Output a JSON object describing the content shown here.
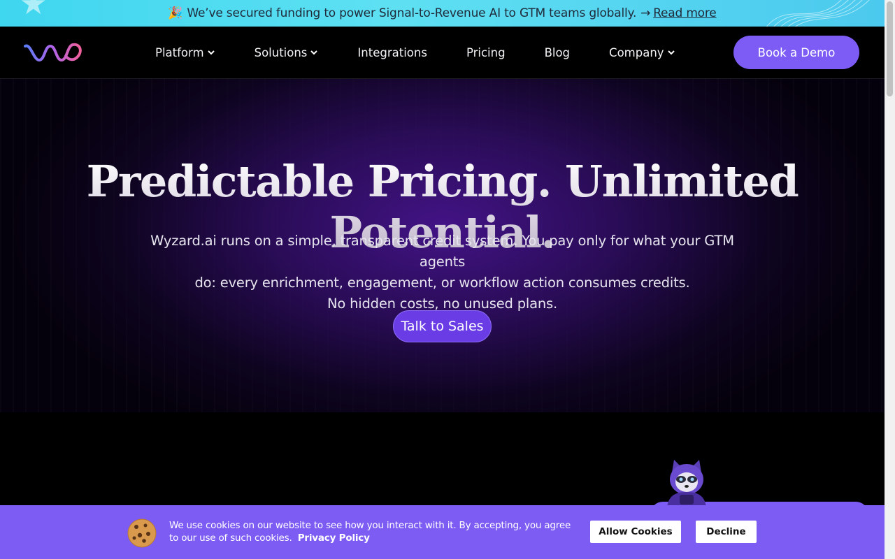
{
  "announcement": {
    "emoji": "🎉",
    "text": "We’ve secured funding to power Signal-to-Revenue AI to GTM teams globally.",
    "arrow": "→",
    "link": "Read more"
  },
  "nav": {
    "items": [
      {
        "label": "Platform",
        "dropdown": true
      },
      {
        "label": "Solutions",
        "dropdown": true
      },
      {
        "label": "Integrations",
        "dropdown": false
      },
      {
        "label": "Pricing",
        "dropdown": false
      },
      {
        "label": "Blog",
        "dropdown": false
      },
      {
        "label": "Company",
        "dropdown": true
      }
    ],
    "cta": "Book a Demo"
  },
  "hero": {
    "title": "Predictable Pricing. Unlimited Potential.",
    "subtitle_lines": [
      "Wyzard.ai runs on a simple, transparent credit system. You pay only for what your GTM agents",
      "do: every enrichment, engagement, or workflow action consumes credits.",
      "No hidden costs, no unused plans."
    ],
    "cta": "Talk to Sales"
  },
  "cookie": {
    "text": "We use cookies on our website to see how you interact with it. By accepting, you agree to our use of such cookies.",
    "policy_link": "Privacy Policy",
    "allow": "Allow Cookies",
    "decline": "Decline"
  },
  "colors": {
    "accent": "#7c5cf5",
    "announcement_bg": "#4fd8f0",
    "cookie_bg": "#7d5cf3"
  }
}
